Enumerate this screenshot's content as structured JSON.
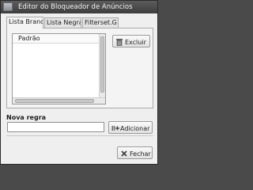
{
  "window": {
    "title": "Editor do Bloqueador de Anúncios"
  },
  "tabs": [
    {
      "label": "Lista Branca",
      "active": true
    },
    {
      "label": "Lista Negra",
      "active": false
    },
    {
      "label": "Filterset.G",
      "active": false
    }
  ],
  "list": {
    "column_header": "Padrão",
    "rows": []
  },
  "buttons": {
    "delete_label": "Excluir",
    "add_label": "Adicionar",
    "close_label": "Fechar"
  },
  "new_rule": {
    "section_label": "Nova regra",
    "value": "",
    "placeholder": ""
  },
  "icons": {
    "app": "app-icon",
    "delete": "trash-icon",
    "add": "add-icon",
    "close": "close-icon"
  }
}
